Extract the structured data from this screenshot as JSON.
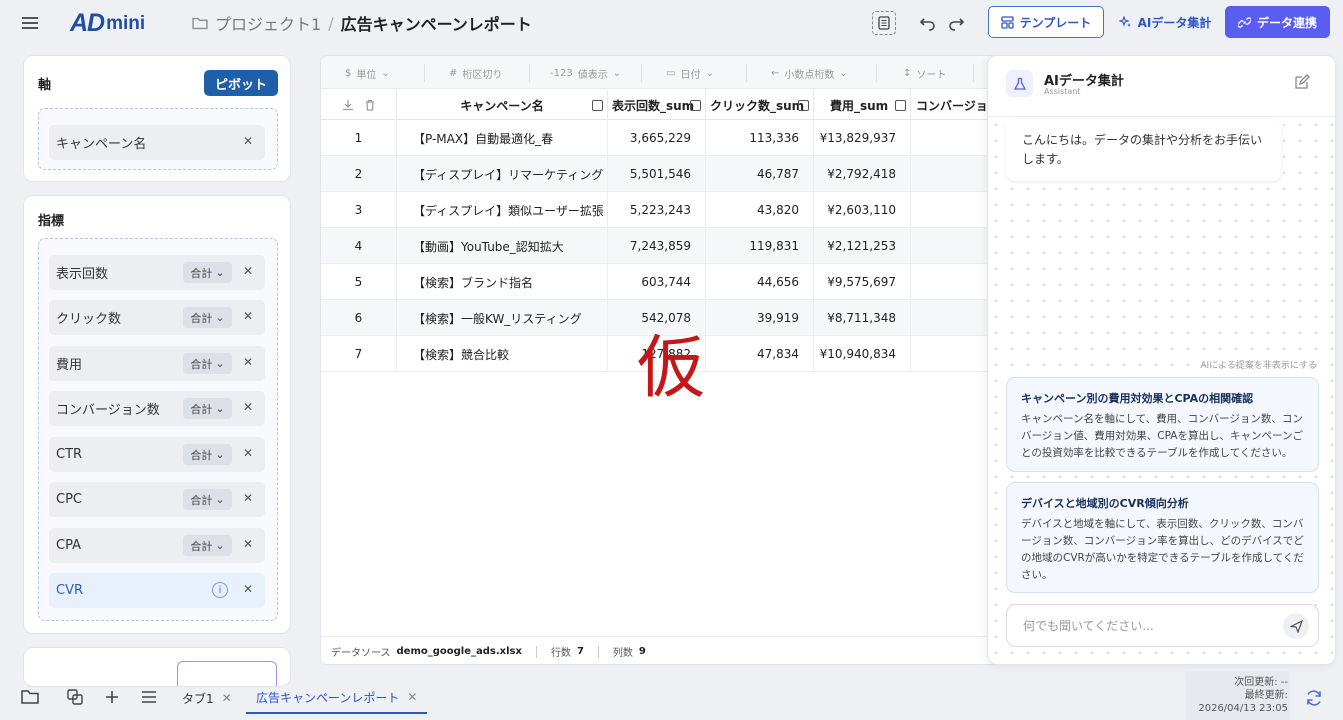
{
  "header": {
    "logo_main": "AD",
    "logo_sub": "mini",
    "breadcrumb_project": "プロジェクト1",
    "breadcrumb_sep": "/",
    "breadcrumb_current": "広告キャンペーンレポート",
    "template_label": "テンプレート",
    "ai_label": "AIデータ集計",
    "link_label": "データ連携",
    "accent_color": "#5a5ef0"
  },
  "axis_panel": {
    "title": "軸",
    "pivot_label": "ピボット",
    "fields": [
      "キャンペーン名"
    ]
  },
  "metric_panel": {
    "title": "指標",
    "agg_label": "合計",
    "fields": [
      "表示回数",
      "クリック数",
      "費用",
      "コンバージョン数",
      "CTR",
      "CPC",
      "CPA"
    ],
    "highlight_field": "CVR",
    "info_mark": "i"
  },
  "toolbar": {
    "unit": "単位",
    "digit_sep": "桁区切り",
    "value_display": "値表示",
    "value_prefix": "-123",
    "date": "日付",
    "decimals": "小数点桁数",
    "sort": "ソート"
  },
  "table": {
    "columns": [
      "キャンペーン名",
      "表示回数_sum",
      "クリック数_sum",
      "費用_sum",
      "コンバージョン"
    ],
    "rows": [
      {
        "no": "1",
        "name": "【P-MAX】自動最適化_春",
        "impr": "3,665,229",
        "clicks": "113,336",
        "cost": "¥13,829,937"
      },
      {
        "no": "2",
        "name": "【ディスプレイ】リマーケティング",
        "impr": "5,501,546",
        "clicks": "46,787",
        "cost": "¥2,792,418"
      },
      {
        "no": "3",
        "name": "【ディスプレイ】類似ユーザー拡張",
        "impr": "5,223,243",
        "clicks": "43,820",
        "cost": "¥2,603,110"
      },
      {
        "no": "4",
        "name": "【動画】YouTube_認知拡大",
        "impr": "7,243,859",
        "clicks": "119,831",
        "cost": "¥2,121,253"
      },
      {
        "no": "5",
        "name": "【検索】ブランド指名",
        "impr": "603,744",
        "clicks": "44,656",
        "cost": "¥9,575,697"
      },
      {
        "no": "6",
        "name": "【検索】一般KW_リスティング",
        "impr": "542,078",
        "clicks": "39,919",
        "cost": "¥8,711,348"
      },
      {
        "no": "7",
        "name": "【検索】競合比較",
        "impr": "127,882",
        "clicks": "47,834",
        "cost": "¥10,940,834"
      }
    ],
    "watermark": "仮",
    "status": {
      "source_label": "データソース",
      "source_value": "demo_google_ads.xlsx",
      "rows_label": "行数",
      "rows_value": "7",
      "cols_label": "列数",
      "cols_value": "9"
    }
  },
  "ai_panel": {
    "title": "AIデータ集計",
    "subtitle": "Assistant",
    "greeting": "こんにちは。データの集計や分析をお手伝いします。",
    "hide_suggest": "AIによる提案を非表示にする",
    "suggestions": [
      {
        "title": "キャンペーン別の費用対効果とCPAの相関確認",
        "desc": "キャンペーン名を軸にして、費用、コンバージョン数、コンバージョン値、費用対効果、CPAを算出し、キャンペーンごとの投資効率を比較できるテーブルを作成してください。"
      },
      {
        "title": "デバイスと地域別のCVR傾向分析",
        "desc": "デバイスと地域を軸にして、表示回数、クリック数、コンバージョン数、コンバージョン率を算出し、どのデバイスでどの地域のCVRが高いかを特定できるテーブルを作成してください。"
      }
    ],
    "input_placeholder": "何でも聞いてください..."
  },
  "bottom": {
    "tabs": [
      "タブ1",
      "広告キャンペーンレポート"
    ],
    "next_update": "次回更新: --",
    "last_update": "最終更新:",
    "last_update_time": "2026/04/13 23:05"
  }
}
